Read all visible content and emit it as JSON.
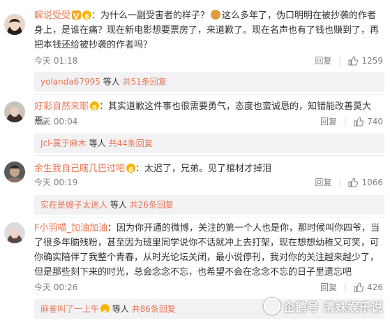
{
  "comments": [
    {
      "username": "解说受受",
      "colon": "：",
      "text_a": "为什么一副受害者的样子？",
      "text_b": "这么多年了，伪口明明在被抄袭的作者身上，是谁在痛？现在新电影想要票房了，来道歉了。现在名声也有了钱也赚到了，再把本钱还给被抄袭的作者吗？",
      "time": "今天 01:18",
      "reply": "回复",
      "likes": "1259",
      "sub_user": "yolanda67995",
      "sub_mid": " 等人 ",
      "sub_count": "共51条回复"
    },
    {
      "username": "好彩自然来耶",
      "colon": "：",
      "text_a": "其实道歉这件事也很需要勇气，态度也蛮诚恳的，知错能改善莫大焉。",
      "time": "今天 00:04",
      "reply": "回复",
      "likes": "740",
      "sub_user": "Jcl-属于麻木",
      "sub_mid": " 等人 ",
      "sub_count": "共44条回复"
    },
    {
      "username": "余生我自己瞎几巴过吧",
      "colon": "：",
      "text_a": "太迟了，兄弟。见了棺材才掉泪",
      "time": "今天 00:19",
      "reply": "回复",
      "likes": "1066",
      "sub_user": "实在是嫂子太迷人",
      "sub_mid": " 等人 ",
      "sub_count": "共26条回复"
    },
    {
      "username": "F小羽喵_加油加油",
      "colon": "：",
      "text_a": "因为你开通的微博，关注的第一个人也是你，那时候叫你四爷，当了很多年脑残粉，甚至因为班里同学说你不话就冲上去打架，现在想想幼稚又可笑，可你确实陪伴了我整个青春，从时光论坛关闭，最小说停刊，我对你的关注越来越少了，但是那些刻下来的时光，总会念念不忘，也希望不会在念念不忘的日子里遗忘吧",
      "time": "今天 00:26",
      "reply": "回复",
      "likes": "426",
      "sub_user": "麻雀叫了一上午",
      "sub_mid": " 等人 ",
      "sub_count": "共86条回复"
    }
  ],
  "watermark": "企鹅号 清妹娱乐说",
  "colors": {
    "username": "#eb7350",
    "text": "#333333",
    "meta": "#808080",
    "subreply_bg": "#f2f2f5"
  }
}
